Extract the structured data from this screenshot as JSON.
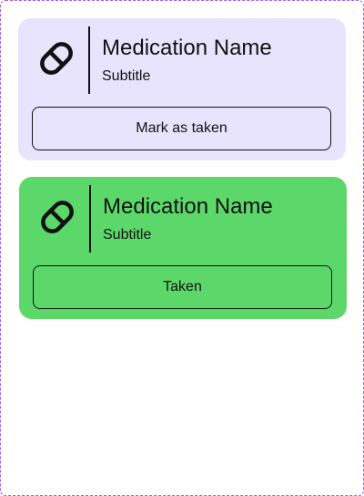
{
  "cards": [
    {
      "title": "Medication Name",
      "subtitle": "Subtitle",
      "button_label": "Mark as taken",
      "icon": "pill-icon",
      "background": "#e8e4fe",
      "state": "not-taken"
    },
    {
      "title": "Medication Name",
      "subtitle": "Subtitle",
      "button_label": "Taken",
      "icon": "pill-icon",
      "background": "#5cd86a",
      "state": "taken"
    }
  ],
  "colors": {
    "frame_border": "#9b5cf0",
    "text": "#111111"
  }
}
